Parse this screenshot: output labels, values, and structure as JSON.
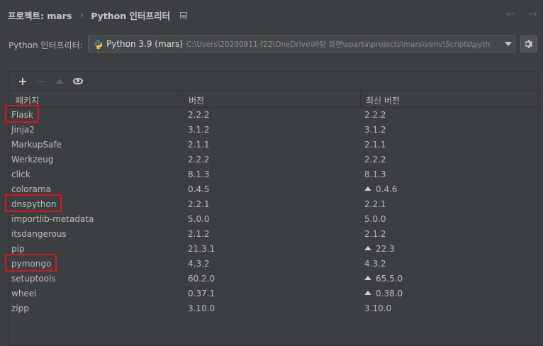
{
  "breadcrumb": {
    "project": "프로젝트: mars",
    "separator": "›",
    "page": "Python 인터프리터"
  },
  "nav": {
    "back": "←",
    "forward": "→"
  },
  "interpreter": {
    "label": "Python 인터프리터:",
    "name": "Python 3.9 (mars)",
    "path": "C:\\Users\\20200911-f22\\OneDrive\\바탕 화면\\sparta\\projects\\mars\\venv\\Scripts\\pyth"
  },
  "toolbar": {
    "add": "+",
    "remove": "−"
  },
  "table": {
    "headers": [
      "패키지",
      "버전",
      "최신 버전"
    ],
    "rows": [
      {
        "package": "Flask",
        "version": "2.2.2",
        "latest": "2.2.2",
        "upgrade": false
      },
      {
        "package": "Jinja2",
        "version": "3.1.2",
        "latest": "3.1.2",
        "upgrade": false
      },
      {
        "package": "MarkupSafe",
        "version": "2.1.1",
        "latest": "2.1.1",
        "upgrade": false
      },
      {
        "package": "Werkzeug",
        "version": "2.2.2",
        "latest": "2.2.2",
        "upgrade": false
      },
      {
        "package": "click",
        "version": "8.1.3",
        "latest": "8.1.3",
        "upgrade": false
      },
      {
        "package": "colorama",
        "version": "0.4.5",
        "latest": "0.4.6",
        "upgrade": true
      },
      {
        "package": "dnspython",
        "version": "2.2.1",
        "latest": "2.2.1",
        "upgrade": false
      },
      {
        "package": "importlib-metadata",
        "version": "5.0.0",
        "latest": "5.0.0",
        "upgrade": false
      },
      {
        "package": "itsdangerous",
        "version": "2.1.2",
        "latest": "2.1.2",
        "upgrade": false
      },
      {
        "package": "pip",
        "version": "21.3.1",
        "latest": "22.3",
        "upgrade": true
      },
      {
        "package": "pymongo",
        "version": "4.3.2",
        "latest": "4.3.2",
        "upgrade": false
      },
      {
        "package": "setuptools",
        "version": "60.2.0",
        "latest": "65.5.0",
        "upgrade": true
      },
      {
        "package": "wheel",
        "version": "0.37.1",
        "latest": "0.38.0",
        "upgrade": true
      },
      {
        "package": "zipp",
        "version": "3.10.0",
        "latest": "3.10.0",
        "upgrade": false
      }
    ],
    "highlighted_packages": [
      "Flask",
      "dnspython",
      "pymongo"
    ]
  },
  "colors": {
    "background": "#3c3f41",
    "highlight": "#e0131c",
    "text": "#bbbbbb"
  }
}
